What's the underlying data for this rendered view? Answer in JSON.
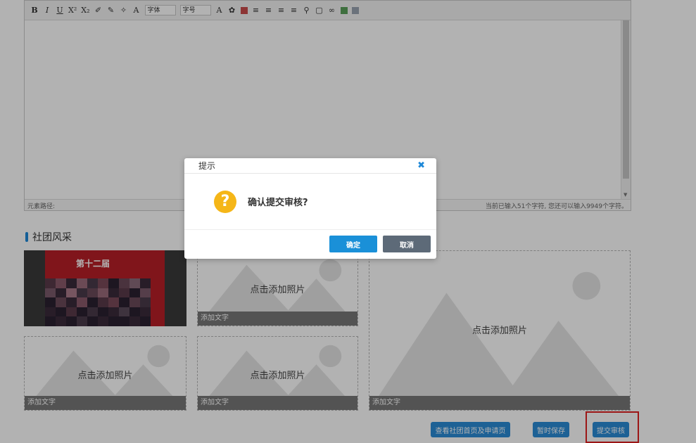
{
  "editor": {
    "toolbar": {
      "bold": "B",
      "italic": "I",
      "underline": "U",
      "superscript": "X²",
      "subscript": "X₂",
      "font_color_a": "A",
      "font_family": "字体",
      "font_size": "字号",
      "highlight_a": "A"
    },
    "status_left": "元素路径:",
    "status_right": "当前已输入51个字符, 您还可以输入9949个字符。"
  },
  "section": {
    "title": "社团风采"
  },
  "photos": {
    "first_stage_text": "第十二届",
    "add_photo_label": "点击添加照片",
    "add_text_label": "添加文字"
  },
  "buttons": {
    "view_home": "查看社团首页及申请页",
    "save_draft": "暂时保存",
    "submit_review": "提交审核"
  },
  "modal": {
    "title": "提示",
    "close_symbol": "✖",
    "icon_glyph": "?",
    "message": "确认提交审核?",
    "confirm": "确定",
    "cancel": "取消"
  },
  "colors": {
    "accent": "#1a90d8",
    "cancel": "#5d6a78",
    "warning": "#f5b618",
    "highlight_box": "#e02020"
  }
}
